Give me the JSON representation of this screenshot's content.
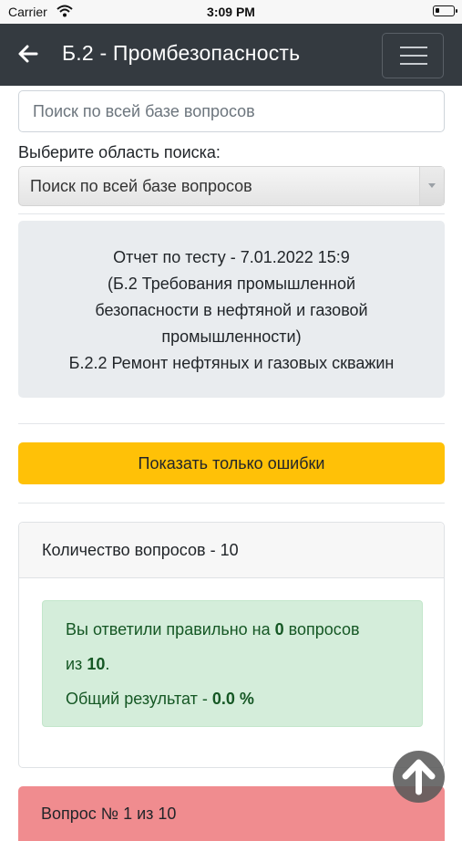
{
  "status": {
    "carrier": "Carrier",
    "time": "3:09 PM"
  },
  "navbar": {
    "title": "Б.2 - Промбезопасность"
  },
  "search": {
    "placeholder": "Поиск по всей базе вопросов",
    "area_label": "Выберите область поиска:",
    "area_selected": "Поиск по всей базе вопросов"
  },
  "report": {
    "lines": [
      "Отчет по тесту - 7.01.2022 15:9",
      "(Б.2 Требования промышленной",
      "безопасности в нефтяной и газовой",
      "промышленности)",
      "Б.2.2 Ремонт нефтяных и газовых скважин"
    ]
  },
  "errors_button": "Показать только ошибки",
  "results": {
    "header": "Количество вопросов - 10",
    "line1_prefix": "Вы ответили правильно на ",
    "correct": "0",
    "line1_suffix": " вопросов",
    "line2_prefix": "из ",
    "total": "10",
    "line2_suffix": ".",
    "line3_prefix": "Общий результат - ",
    "percent": "0.0 %"
  },
  "question": {
    "header": "Вопрос № 1 из 10"
  },
  "icons": {
    "back": "arrow-left-icon",
    "menu": "hamburger-icon",
    "scroll_top": "arrow-up-icon"
  }
}
